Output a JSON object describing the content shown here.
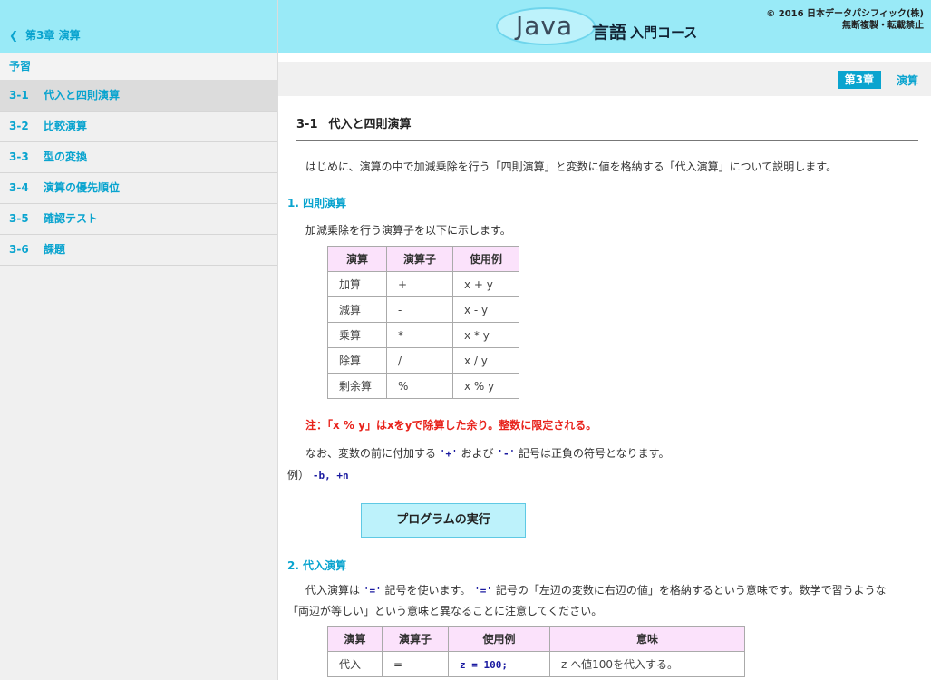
{
  "sidebar": {
    "back_label": "第3章 演算",
    "section_label": "予習",
    "items": [
      {
        "num": "3-1",
        "label": "代入と四則演算"
      },
      {
        "num": "3-2",
        "label": "比較演算"
      },
      {
        "num": "3-3",
        "label": "型の変換"
      },
      {
        "num": "3-4",
        "label": "演算の優先順位"
      },
      {
        "num": "3-5",
        "label": "確認テスト"
      },
      {
        "num": "3-6",
        "label": "課題"
      }
    ]
  },
  "header": {
    "logo_java": "Java",
    "logo_gengo": "言語",
    "logo_course": "入門コース",
    "copyright_line1": "© 2016 日本データパシフィック(株)",
    "copyright_line2": "無断複製・転載禁止"
  },
  "chapter": {
    "badge": "第3章",
    "name": "演算"
  },
  "page": {
    "title_num": "3-1",
    "title_text": "代入と四則演算",
    "intro": "はじめに、演算の中で加減乗除を行う「四則演算」と変数に値を格納する「代入演算」について説明します。"
  },
  "section1": {
    "heading": "1. 四則演算",
    "desc": "加減乗除を行う演算子を以下に示します。",
    "table": {
      "headers": [
        "演算",
        "演算子",
        "使用例"
      ],
      "rows": [
        [
          "加算",
          "+",
          "x + y"
        ],
        [
          "減算",
          "-",
          "x - y"
        ],
        [
          "乗算",
          "*",
          "x * y"
        ],
        [
          "除算",
          "/",
          "x / y"
        ],
        [
          "剰余算",
          "%",
          "x % y"
        ]
      ]
    },
    "note": "注：「x % y」はxをyで除算した余り。整数に限定される。",
    "sign_text_pre": "なお、変数の前に付加する ",
    "sign_plus": "'+'",
    "sign_text_mid": " および ",
    "sign_minus": "'-'",
    "sign_text_post": " 記号は正負の符号となります。",
    "example_label": "例）",
    "example_code": "-b, +n",
    "run_button": "プログラムの実行"
  },
  "section2": {
    "heading": "2. 代入演算",
    "desc1_pre": "代入演算は ",
    "desc1_sym1": "'='",
    "desc1_mid": " 記号を使います。 ",
    "desc1_sym2": "'='",
    "desc1_post": " 記号の「左辺の変数に右辺の値」を格納するという意味です。数学で習うような",
    "desc2": "「両辺が等しい」という意味と異なることに注意してください。",
    "table": {
      "headers": [
        "演算",
        "演算子",
        "使用例",
        "意味"
      ],
      "rows": [
        [
          "代入",
          "=",
          "z = 100;",
          "z へ値100を代入する。"
        ]
      ]
    }
  }
}
